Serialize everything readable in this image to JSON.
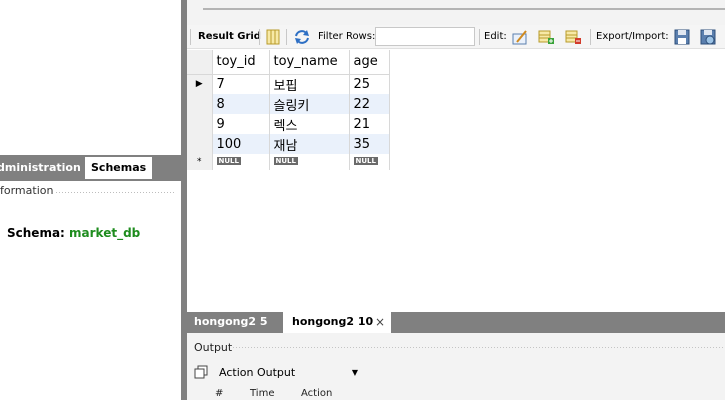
{
  "left_panel": {
    "tabs": [
      "dministration",
      "Schemas"
    ],
    "info_header": "formation",
    "schema_label": "Schema:",
    "schema_value": "market_db"
  },
  "toolbar": {
    "result_grid": "Result Grid",
    "filter_rows": "Filter Rows:",
    "filter_value": "",
    "edit": "Edit:",
    "export_import": "Export/Import:"
  },
  "grid": {
    "columns": [
      "toy_id",
      "toy_name",
      "age"
    ],
    "rows": [
      [
        "7",
        "보핍",
        "25"
      ],
      [
        "8",
        "슬링키",
        "22"
      ],
      [
        "9",
        "렉스",
        "21"
      ],
      [
        "100",
        "재남",
        "35"
      ]
    ],
    "null_label": "NULL",
    "new_row_marker": "*",
    "current_row_marker": "▶"
  },
  "bottom_tabs": {
    "tab1": "hongong2 5",
    "tab2": "hongong2 10",
    "close": "×"
  },
  "output": {
    "title": "Output",
    "select_value": "Action Output",
    "columns": [
      "#",
      "Time",
      "Action"
    ]
  },
  "colors": {
    "panel_gray": "#808080",
    "schema_green": "#1e8c1e",
    "alt_row": "#eaf1fb"
  }
}
